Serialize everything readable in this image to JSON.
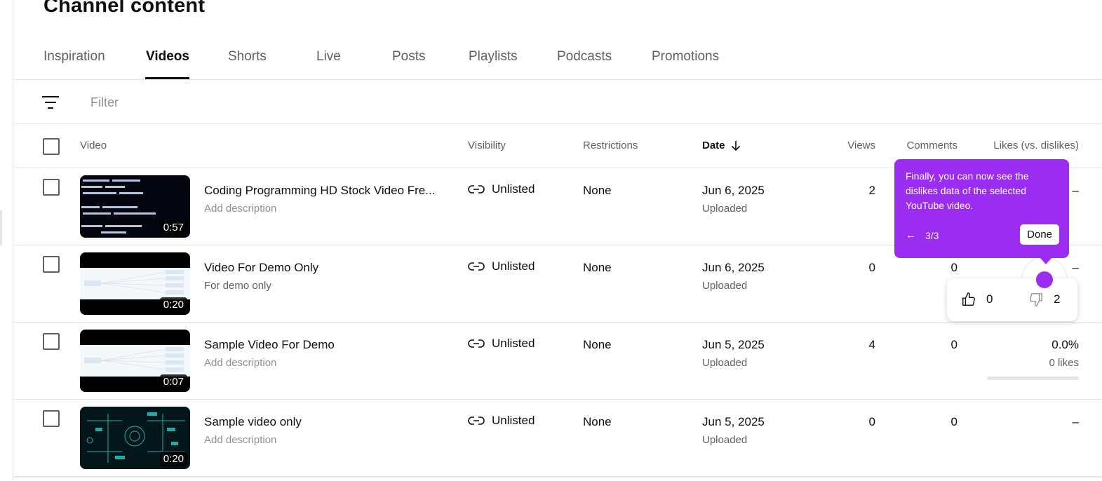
{
  "page": {
    "title": "Channel content"
  },
  "tabs": [
    "Inspiration",
    "Videos",
    "Shorts",
    "Live",
    "Posts",
    "Playlists",
    "Podcasts",
    "Promotions"
  ],
  "active_tab": "Videos",
  "filter": {
    "placeholder": "Filter"
  },
  "columns": {
    "video": "Video",
    "visibility": "Visibility",
    "restrictions": "Restrictions",
    "date": "Date",
    "views": "Views",
    "comments": "Comments",
    "likes": "Likes (vs. dislikes)"
  },
  "rows": [
    {
      "title": "Coding Programming HD Stock Video Fre...",
      "description": "Add description",
      "duration": "0:57",
      "visibility": "Unlisted",
      "restrictions": "None",
      "date": "Jun 6, 2025",
      "status": "Uploaded",
      "views": "2",
      "comments": "",
      "likes": "–",
      "likes_sub": ""
    },
    {
      "title": "Video For Demo Only",
      "description": "For demo only",
      "duration": "0:20",
      "visibility": "Unlisted",
      "restrictions": "None",
      "date": "Jun 6, 2025",
      "status": "Uploaded",
      "views": "0",
      "comments": "0",
      "likes": "–",
      "likes_sub": ""
    },
    {
      "title": "Sample Video For Demo",
      "description": "Add description",
      "duration": "0:07",
      "visibility": "Unlisted",
      "restrictions": "None",
      "date": "Jun 5, 2025",
      "status": "Uploaded",
      "views": "4",
      "comments": "0",
      "likes": "0.0%",
      "likes_sub": "0 likes"
    },
    {
      "title": "Sample video only",
      "description": "Add description",
      "duration": "0:20",
      "visibility": "Unlisted",
      "restrictions": "None",
      "date": "Jun 5, 2025",
      "status": "Uploaded",
      "views": "0",
      "comments": "0",
      "likes": "–",
      "likes_sub": ""
    }
  ],
  "tooltip": {
    "text": "Finally, you can now see the dislikes data of the selected YouTube video.",
    "back": "←",
    "step": "3/3",
    "done": "Done"
  },
  "popover": {
    "likes": "0",
    "dislikes": "2"
  },
  "colors": {
    "accent": "#9b2df0"
  }
}
